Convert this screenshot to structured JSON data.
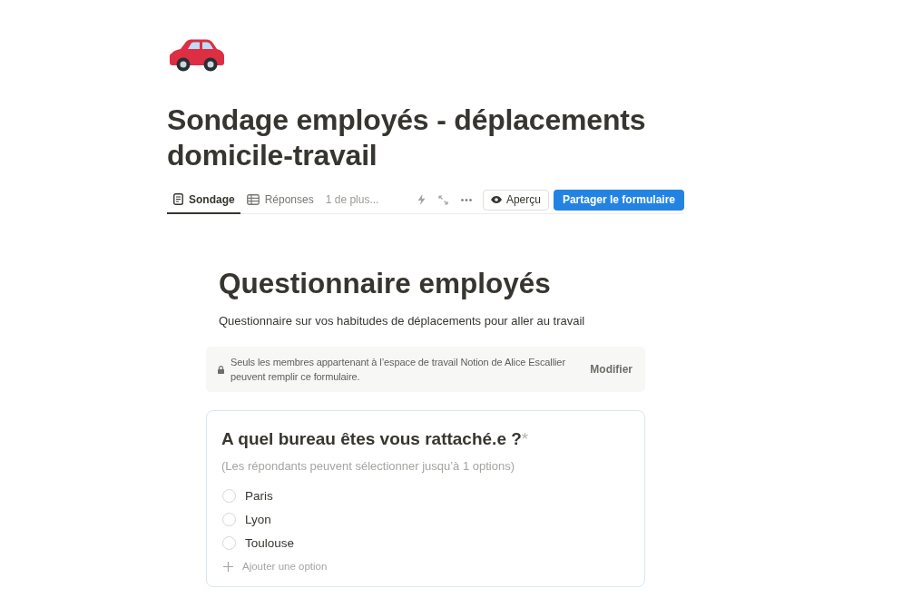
{
  "page": {
    "title": "Sondage employés - déplacements domicile-travail"
  },
  "views": {
    "tabs": [
      {
        "label": "Sondage",
        "kind": "form",
        "selected": true
      },
      {
        "label": "Réponses",
        "kind": "table",
        "selected": false
      }
    ],
    "more": "1 de plus...",
    "preview_button": "Aperçu",
    "share_button": "Partager le formulaire"
  },
  "form": {
    "title": "Questionnaire employés",
    "description": "Questionnaire sur vos habitudes de déplacements pour aller au travail",
    "access_notice": {
      "text": "Seuls les membres appartenant à l’espace de travail Notion de Alice Escallier peuvent remplir ce formulaire.",
      "action": "Modifier"
    },
    "questions": [
      {
        "title": "A quel bureau êtes vous rattaché.e ?",
        "required_mark": "*",
        "hint": "(Les répondants peuvent sélectionner jusqu’à 1 options)",
        "options": [
          {
            "label": "Paris",
            "selected": false
          },
          {
            "label": "Lyon",
            "selected": false
          },
          {
            "label": "Toulouse",
            "selected": false
          }
        ],
        "add_option": "Ajouter une option"
      }
    ]
  }
}
